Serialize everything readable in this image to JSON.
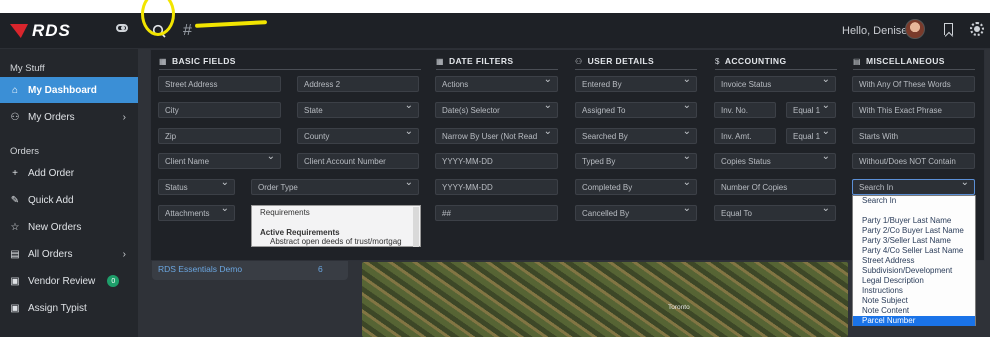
{
  "topbar": {
    "logo_text": "RDS",
    "hash": "#",
    "greeting": "Hello, Denise",
    "icons": [
      "toggle-icon",
      "search-icon",
      "bookmark-icon",
      "sun-icon"
    ]
  },
  "sidebar": {
    "section_1": "My Stuff",
    "section_2": "Orders",
    "items": [
      {
        "label": "My Dashboard",
        "icon": "⌂"
      },
      {
        "label": "My Orders",
        "icon": "⚇"
      },
      {
        "label": "Add Order",
        "icon": "+"
      },
      {
        "label": "Quick Add",
        "icon": "✎"
      },
      {
        "label": "New Orders",
        "icon": "☆"
      },
      {
        "label": "All Orders",
        "icon": "▤"
      },
      {
        "label": "Vendor Review",
        "icon": "▣",
        "badge": "0"
      },
      {
        "label": "Assign Typist",
        "icon": "▣"
      }
    ]
  },
  "background": {
    "card_link": "RDS Essentials Demo",
    "card_count": "6",
    "map_city": "Toronto"
  },
  "search_panel": {
    "basic_fields": {
      "title": "BASIC FIELDS",
      "street_address": "Street Address",
      "address_2": "Address 2",
      "city": "City",
      "state": "State",
      "zip": "Zip",
      "county": "County",
      "client_name": "Client Name",
      "client_account_number": "Client Account Number",
      "status": "Status",
      "order_type": "Order Type",
      "attachments": "Attachments",
      "order_type_options": [
        "Requirements",
        "Active Requirements",
        "Abstract open deeds of trust/mortgag"
      ]
    },
    "date_filters": {
      "title": "DATE FILTERS",
      "actions": "Actions",
      "date_selector": "Date(s) Selector",
      "narrow_by_user": "Narrow By User (Not Read",
      "date_from": "YYYY-MM-DD",
      "date_to": "YYYY-MM-DD",
      "number": "##"
    },
    "user_details": {
      "title": "USER DETAILS",
      "entered_by": "Entered By",
      "assigned_to": "Assigned To",
      "searched_by": "Searched By",
      "typed_by": "Typed By",
      "completed_by": "Completed By",
      "cancelled_by": "Cancelled By"
    },
    "accounting": {
      "title": "ACCOUNTING",
      "invoice_status": "Invoice Status",
      "inv_no": "Inv. No.",
      "equal_1a": "Equal 1",
      "inv_amt": "Inv. Amt.",
      "equal_1b": "Equal 1",
      "copies_status": "Copies Status",
      "number_of_copies": "Number Of Copies",
      "equal_to": "Equal To"
    },
    "miscellaneous": {
      "title": "MISCELLANEOUS",
      "any_words": "With Any Of These Words",
      "exact_phrase": "With This Exact Phrase",
      "starts_with": "Starts With",
      "without": "Without/Does NOT Contain",
      "search_in": "Search In",
      "search_in_options": [
        "Search In",
        "",
        "Party 1/Buyer Last Name",
        "Party 2/Co Buyer Last Name",
        "Party 3/Seller Last Name",
        "Party 4/Co Seller Last Name",
        "Street Address",
        "Subdivision/Development",
        "Legal Description",
        "Instructions",
        "Note Subject",
        "Note Content",
        "Parcel Number"
      ],
      "selected_option": "Parcel Number"
    }
  }
}
